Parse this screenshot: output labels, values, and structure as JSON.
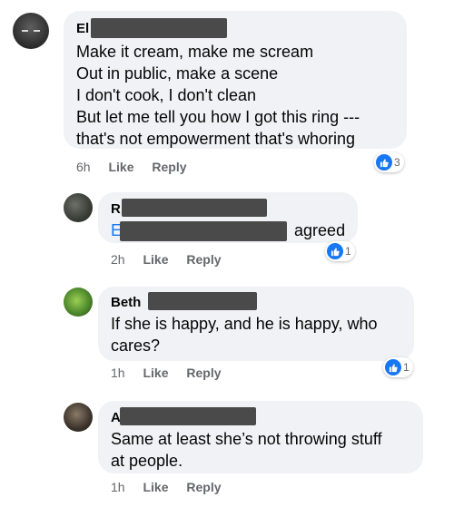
{
  "comments": [
    {
      "name_prefix": "El",
      "text": [
        "Make it cream, make me scream",
        "Out in public, make a scene",
        "I don't cook, I don't clean",
        "But let me tell you how I got this ring ---",
        "that's not empowerment that's whoring"
      ],
      "time": "6h",
      "like_label": "Like",
      "reply_label": "Reply",
      "reaction_count": "3"
    },
    {
      "name_prefix": "R",
      "mention_prefix": "E",
      "text_suffix": "agreed",
      "time": "2h",
      "like_label": "Like",
      "reply_label": "Reply",
      "reaction_count": "1"
    },
    {
      "name_prefix": "Beth",
      "text": [
        "If she is happy, and he is happy, who",
        "cares?"
      ],
      "time": "1h",
      "like_label": "Like",
      "reply_label": "Reply",
      "reaction_count": "1"
    },
    {
      "name_prefix": "A",
      "text": [
        "Same at least she’s not throwing stuff",
        "at people."
      ],
      "time": "1h",
      "like_label": "Like",
      "reply_label": "Reply"
    }
  ],
  "colors": {
    "bubble": "#f0f2f5",
    "mention": "#1877f2",
    "like_icon": "#1877f2",
    "redaction": "#4a4a4a"
  },
  "icons": [
    "avatar",
    "thumbs-up-icon"
  ]
}
